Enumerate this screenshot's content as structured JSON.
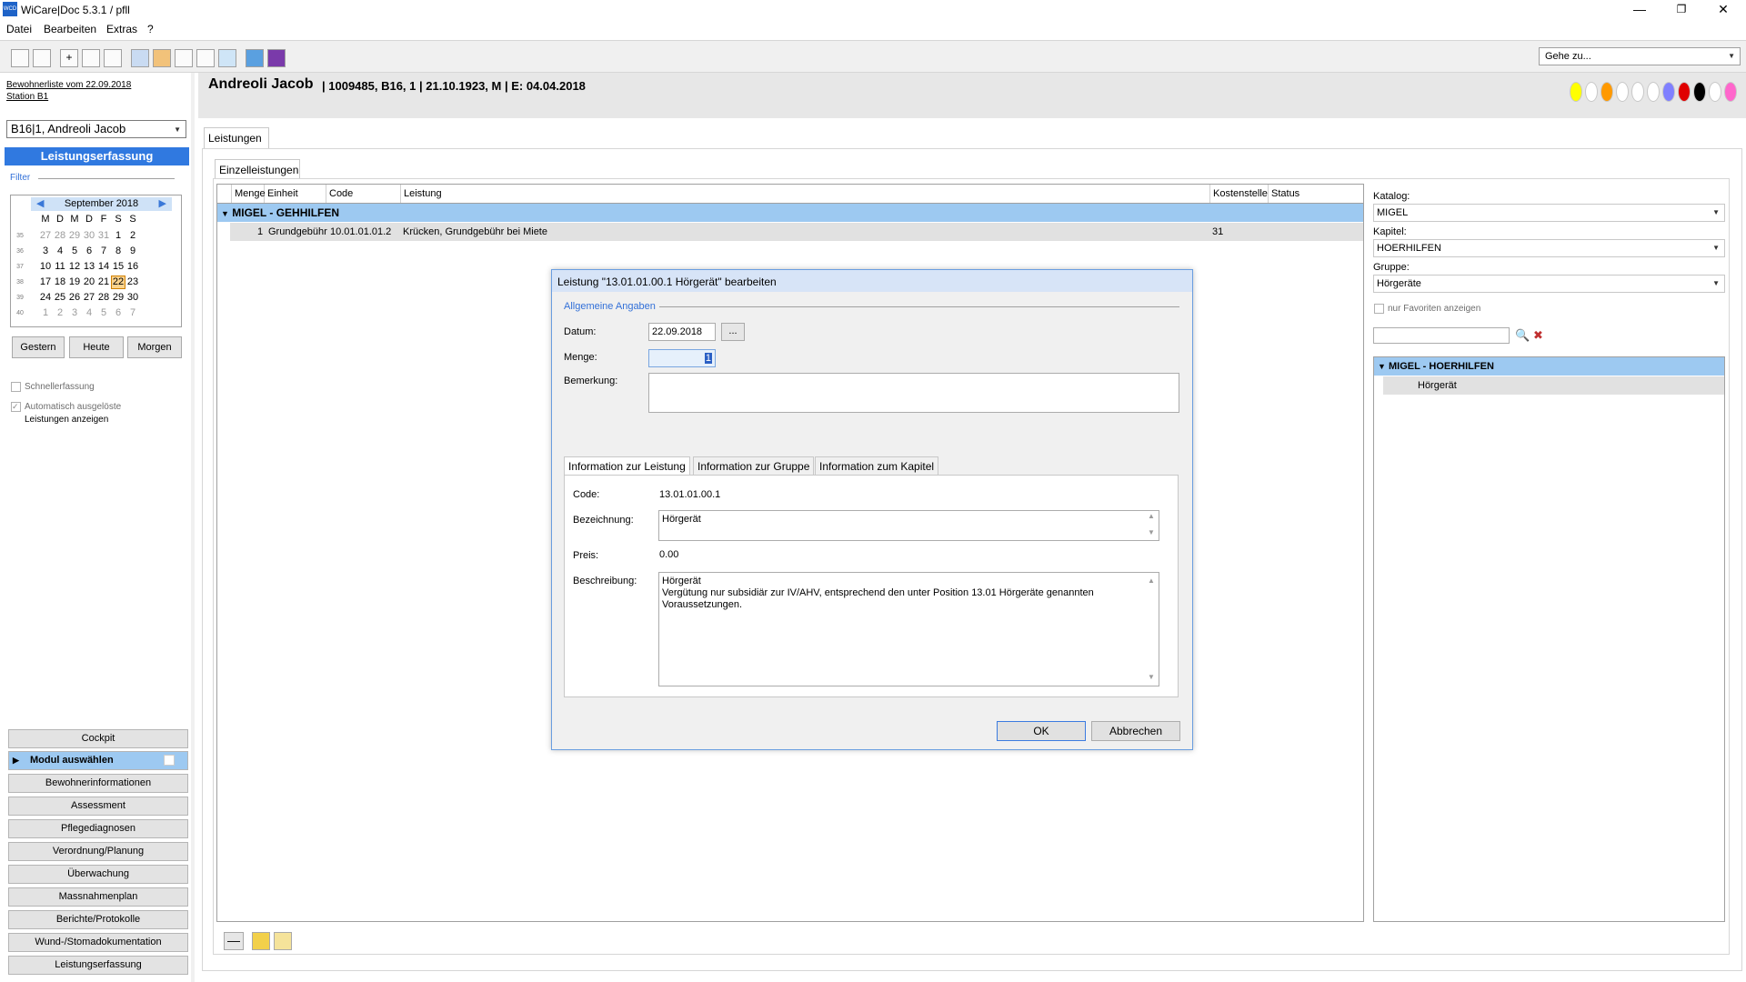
{
  "window": {
    "title": "WiCare|Doc 5.3.1  / pfll",
    "app_icon": "WCD"
  },
  "menu": [
    "Datei",
    "Bearbeiten",
    "Extras",
    "?"
  ],
  "toolbar": {
    "goto_placeholder": "Gehe zu...",
    "icons": [
      "save-icon",
      "undo-icon",
      "add-icon",
      "window-icon",
      "edit-icon",
      "person-search-icon",
      "person-icon",
      "person-delete-icon",
      "person-edit-icon",
      "refresh-icon",
      "print-icon",
      "color-icon"
    ]
  },
  "left": {
    "list_link": "Bewohnerliste vom 22.09.2018",
    "station_link": "Station B1",
    "resident": "B16|1, Andreoli Jacob",
    "section_title": "Leistungserfassung",
    "filter_label": "Filter",
    "calendar": {
      "month": "September 2018",
      "weekday_headers": [
        "M",
        "D",
        "M",
        "D",
        "F",
        "S",
        "S"
      ],
      "weeks": [
        {
          "wk": "35",
          "days": [
            "27",
            "28",
            "29",
            "30",
            "31",
            "1",
            "2"
          ]
        },
        {
          "wk": "36",
          "days": [
            "3",
            "4",
            "5",
            "6",
            "7",
            "8",
            "9"
          ]
        },
        {
          "wk": "37",
          "days": [
            "10",
            "11",
            "12",
            "13",
            "14",
            "15",
            "16"
          ]
        },
        {
          "wk": "38",
          "days": [
            "17",
            "18",
            "19",
            "20",
            "21",
            "22",
            "23"
          ]
        },
        {
          "wk": "39",
          "days": [
            "24",
            "25",
            "26",
            "27",
            "28",
            "29",
            "30"
          ]
        },
        {
          "wk": "40",
          "days": [
            "1",
            "2",
            "3",
            "4",
            "5",
            "6",
            "7"
          ]
        }
      ],
      "selected_day": "22"
    },
    "btn_gestern": "Gestern",
    "btn_heute": "Heute",
    "btn_morgen": "Morgen",
    "chk_schnell": "Schnellerfassung",
    "chk_auto_1": "Automatisch ausgelöste",
    "chk_auto_2": "Leistungen anzeigen",
    "nav": {
      "cockpit": "Cockpit",
      "modul": "Modul auswählen",
      "items": [
        "Bewohnerinformationen",
        "Assessment",
        "Pflegediagnosen",
        "Verordnung/Planung",
        "Überwachung",
        "Massnahmenplan",
        "Berichte/Protokolle",
        "Wund-/Stomadokumentation",
        "Leistungserfassung"
      ]
    }
  },
  "header": {
    "name": "Andreoli Jacob",
    "meta": "| 1009485, B16, 1 | 21.10.1923, M | E: 04.04.2018",
    "dot_colors": [
      "#ffff00",
      "#ffffff",
      "#ff9900",
      "#ffffff",
      "#ffffff",
      "#ffffff",
      "#8080ff",
      "#e00000",
      "#000000",
      "#ffffff",
      "#ff66cc"
    ]
  },
  "tabs": {
    "main": "Leistungen",
    "sub": "Einzelleistungen"
  },
  "grid": {
    "columns": [
      "Menge",
      "Einheit",
      "Code",
      "Leistung",
      "Kostenstelle",
      "Status"
    ],
    "group": "MIGEL - GEHHILFEN",
    "rows": [
      {
        "menge": "1",
        "einheit": "Grundgebühr",
        "code": "10.01.01.01.2",
        "leistung": "Krücken, Grundgebühr bei Miete",
        "kostenstelle": "31",
        "status": ""
      }
    ]
  },
  "catalog": {
    "katalog_label": "Katalog:",
    "katalog_value": "MIGEL",
    "kapitel_label": "Kapitel:",
    "kapitel_value": "HOERHILFEN",
    "gruppe_label": "Gruppe:",
    "gruppe_value": "Hörgeräte",
    "fav_label": "nur Favoriten anzeigen",
    "search_value": "",
    "group": "MIGEL - HOERHILFEN",
    "items": [
      "Hörgerät"
    ]
  },
  "dialog": {
    "title": "Leistung \"13.01.01.00.1 Hörgerät\" bearbeiten",
    "section": "Allgemeine Angaben",
    "datum_label": "Datum:",
    "datum_value": "22.09.2018",
    "datum_btn": "...",
    "menge_label": "Menge:",
    "menge_value": "1",
    "bemerkung_label": "Bemerkung:",
    "bemerkung_value": "",
    "tabs": [
      "Information zur Leistung",
      "Information zur Gruppe",
      "Information zum Kapitel"
    ],
    "code_label": "Code:",
    "code_value": "13.01.01.00.1",
    "bez_label": "Bezeichnung:",
    "bez_value": "Hörgerät",
    "preis_label": "Preis:",
    "preis_value": "0.00",
    "beschr_label": "Beschreibung:",
    "beschr_line1": "Hörgerät",
    "beschr_line2": "Vergütung nur subsidiär zur IV/AHV, entsprechend den unter Position 13.01 Hörgeräte genannten",
    "beschr_line3": "Voraussetzungen.",
    "ok": "OK",
    "cancel": "Abbrechen"
  }
}
